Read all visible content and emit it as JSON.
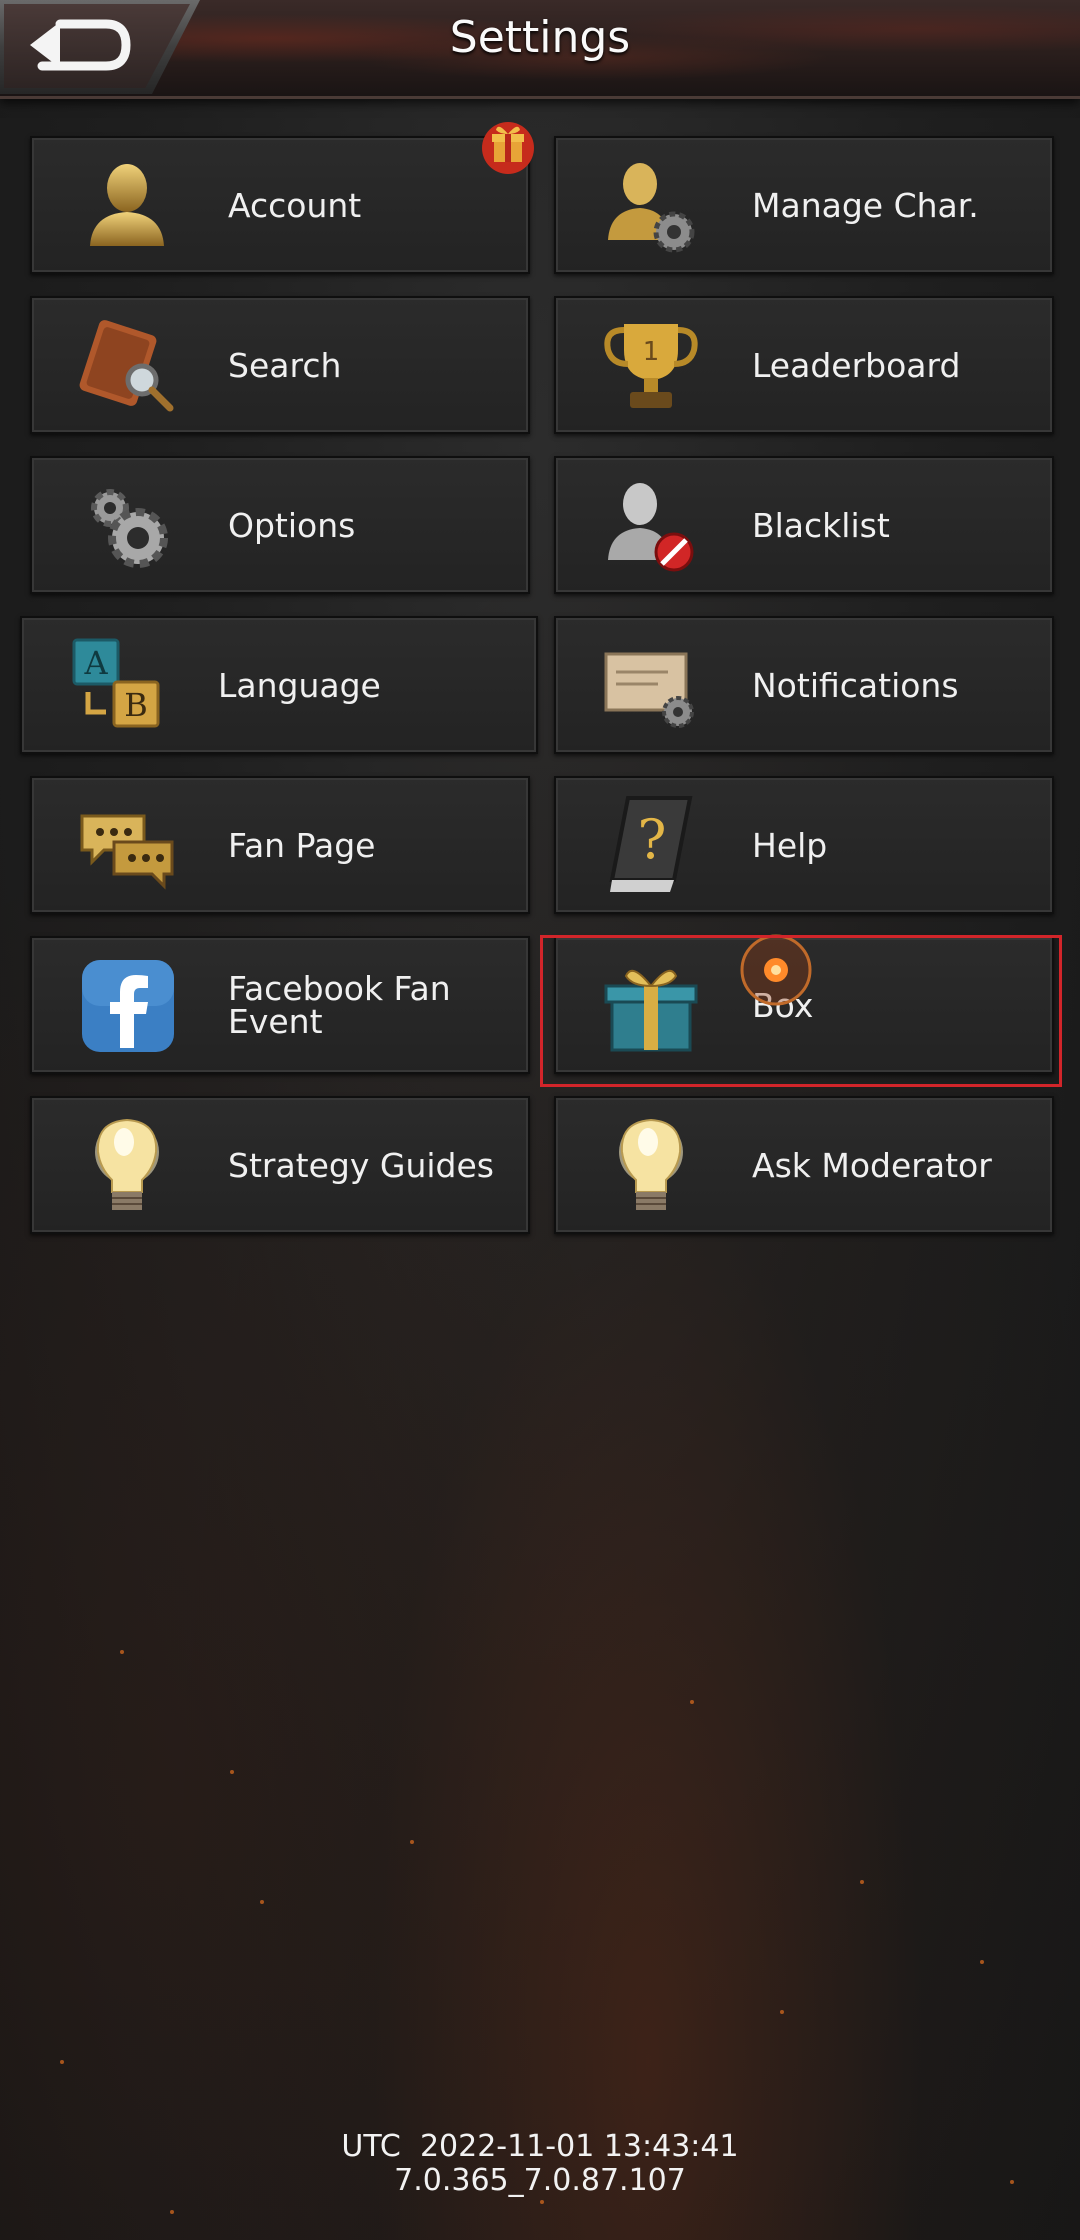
{
  "header": {
    "title": "Settings",
    "back_icon": "back-arrow-icon"
  },
  "menu": [
    {
      "key": "account",
      "label": "Account",
      "icon": "user-silhouette-icon"
    },
    {
      "key": "manage-char",
      "label": "Manage Char.",
      "icon": "user-gear-icon"
    },
    {
      "key": "search",
      "label": "Search",
      "icon": "magnifier-book-icon"
    },
    {
      "key": "leaderboard",
      "label": "Leaderboard",
      "icon": "trophy-icon"
    },
    {
      "key": "options",
      "label": "Options",
      "icon": "gears-icon"
    },
    {
      "key": "blacklist",
      "label": "Blacklist",
      "icon": "user-blocked-icon"
    },
    {
      "key": "language",
      "label": "Language",
      "icon": "language-ab-icon"
    },
    {
      "key": "notifications",
      "label": "Notifications",
      "icon": "letter-gear-icon"
    },
    {
      "key": "fan-page",
      "label": "Fan Page",
      "icon": "chat-bubbles-icon"
    },
    {
      "key": "help",
      "label": "Help",
      "icon": "question-book-icon"
    },
    {
      "key": "facebook-fan-event",
      "label": "Facebook Fan Event",
      "icon": "facebook-icon"
    },
    {
      "key": "box",
      "label": "Box",
      "icon": "gift-box-icon"
    },
    {
      "key": "strategy-guides",
      "label": "Strategy Guides",
      "icon": "lightbulb-icon"
    },
    {
      "key": "ask-moderator",
      "label": "Ask Moderator",
      "icon": "lightbulb-icon"
    }
  ],
  "badges": {
    "account_gift": "gift-badge-icon"
  },
  "footer": {
    "utc": "UTC  2022-11-01 13:43:41",
    "version": "7.0.365_7.0.87.107"
  },
  "colors": {
    "highlight": "#d2252a",
    "gold": "#c9a23c",
    "facebook": "#3b7fc4"
  }
}
